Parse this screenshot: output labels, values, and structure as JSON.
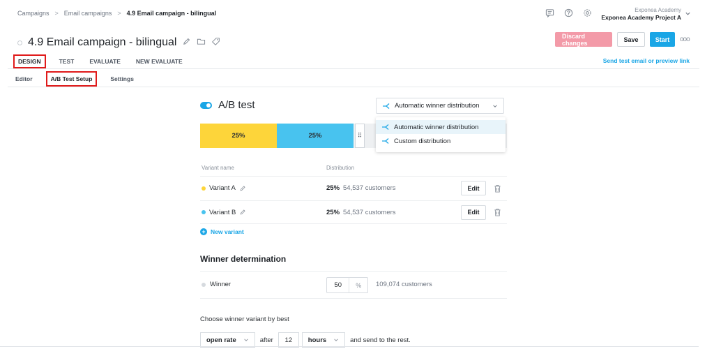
{
  "breadcrumb": {
    "items": [
      "Campaigns",
      "Email campaigns"
    ],
    "current": "4.9 Email campaign - bilingual",
    "separator": ">"
  },
  "account": {
    "org": "Exponea Academy",
    "project": "Exponea Academy Project A"
  },
  "page": {
    "title": "4.9 Email campaign - bilingual"
  },
  "actions": {
    "discard_label": "Discard changes",
    "save_label": "Save",
    "start_label": "Start",
    "more_label": "ooo"
  },
  "main_tabs": [
    {
      "label": "DESIGN",
      "active": true
    },
    {
      "label": "TEST",
      "active": false
    },
    {
      "label": "EVALUATE",
      "active": false
    },
    {
      "label": "NEW EVALUATE",
      "active": false
    }
  ],
  "send_test_link": "Send test email or preview link",
  "sub_tabs": [
    {
      "label": "Editor",
      "active": false
    },
    {
      "label": "A/B Test Setup",
      "active": true
    },
    {
      "label": "Settings",
      "active": false
    }
  ],
  "ab_test": {
    "title": "A/B test",
    "enabled": true,
    "distribution_select": "Automatic winner distribution",
    "dropdown_options": [
      {
        "label": "Automatic winner distribution",
        "selected": true
      },
      {
        "label": "Custom distribution",
        "selected": false
      }
    ],
    "segments": [
      {
        "label": "25%",
        "share": 0.25,
        "color": "#fdd53a"
      },
      {
        "label": "25%",
        "share": 0.25,
        "color": "#48c3ef"
      }
    ],
    "columns": {
      "name": "Variant name",
      "distribution": "Distribution"
    },
    "variants": [
      {
        "name": "Variant A",
        "pct": "25%",
        "customers": "54,537 customers",
        "color": "#fdd53a",
        "edit_label": "Edit"
      },
      {
        "name": "Variant B",
        "pct": "25%",
        "customers": "54,537 customers",
        "color": "#48c3ef",
        "edit_label": "Edit"
      }
    ],
    "new_variant_label": "New variant"
  },
  "winner": {
    "title": "Winner determination",
    "label": "Winner",
    "value": "50",
    "unit": "%",
    "customers": "109,074 customers",
    "choose_label": "Choose winner variant by best",
    "metric": "open rate",
    "after_text": "after",
    "after_value": "12",
    "time_unit": "hours",
    "send_text": "and send to the rest."
  },
  "colors": {
    "accent": "#1aa6e6",
    "discard": "#f39aa8",
    "highlight_box": "#e01a1a"
  }
}
